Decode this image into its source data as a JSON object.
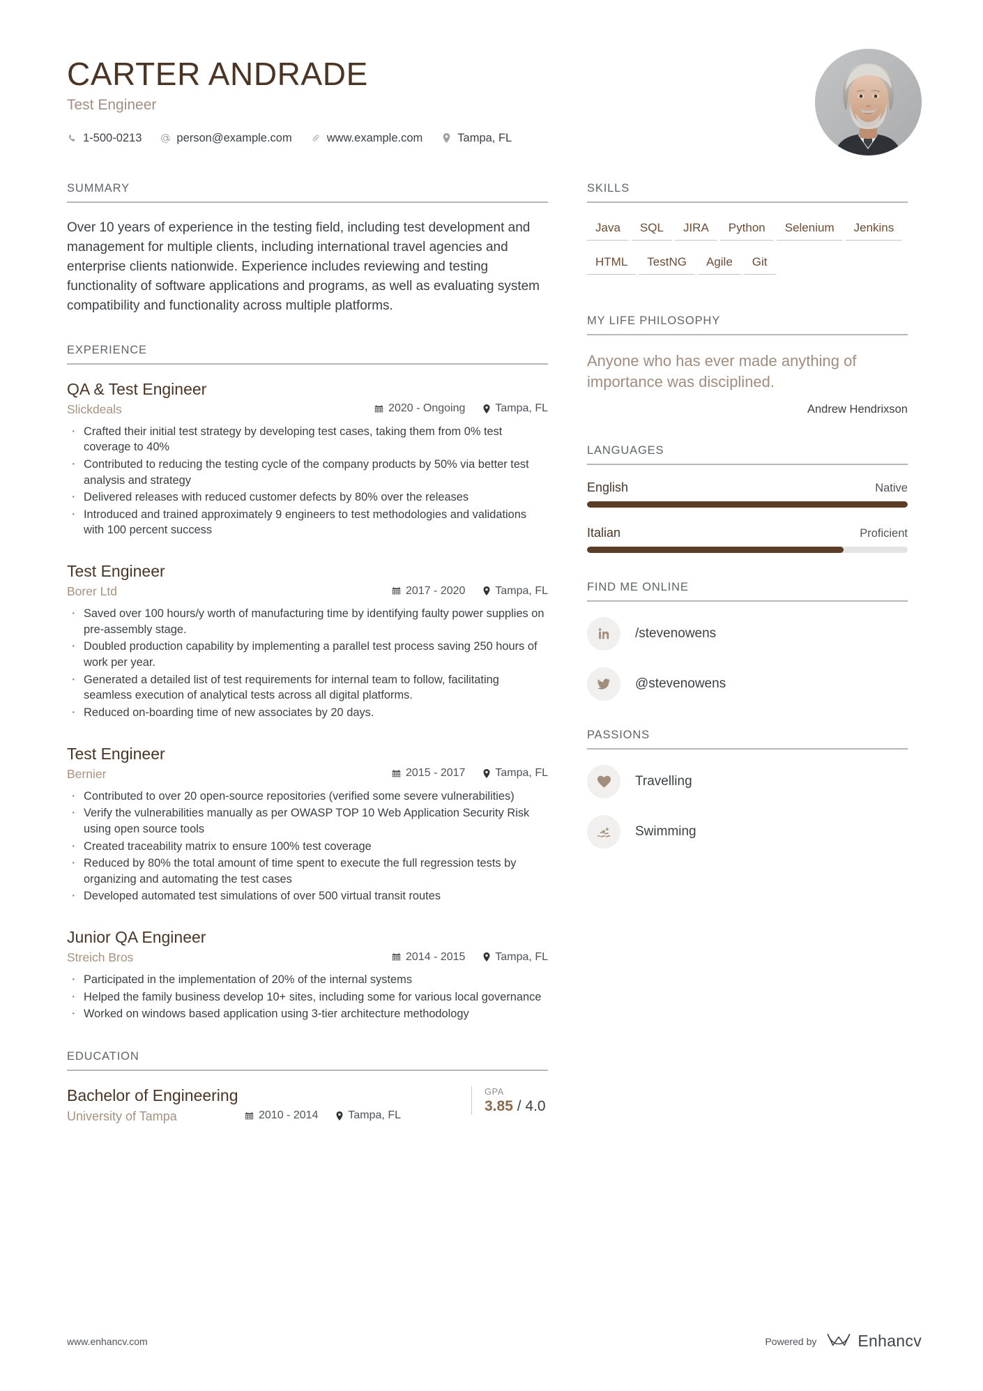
{
  "header": {
    "name": "CARTER ANDRADE",
    "job_title": "Test Engineer",
    "contacts": [
      {
        "icon": "phone-icon",
        "value": "1-500-0213"
      },
      {
        "icon": "email-icon",
        "value": "person@example.com"
      },
      {
        "icon": "link-icon",
        "value": "www.example.com"
      },
      {
        "icon": "location-pin-icon",
        "value": "Tampa, FL"
      }
    ]
  },
  "summary": {
    "title": "SUMMARY",
    "text": "Over 10 years of experience in the testing field, including test development and management for multiple clients, including international travel agencies and enterprise clients nationwide. Experience includes reviewing and testing functionality of software applications and programs, as well as evaluating system compatibility and functionality across multiple platforms."
  },
  "experience": {
    "title": "EXPERIENCE",
    "jobs": [
      {
        "role": "QA & Test Engineer",
        "company": "Slickdeals",
        "dates": "2020 - Ongoing",
        "location": "Tampa, FL",
        "bullets": [
          "Crafted their initial test strategy by developing test cases, taking them from 0% test coverage to 40%",
          "Contributed to reducing the testing cycle of the company products by 50% via better test analysis and strategy",
          "Delivered releases with reduced customer defects by 80% over the releases",
          "Introduced and trained approximately 9 engineers to test methodologies and validations with 100 percent success"
        ]
      },
      {
        "role": "Test Engineer",
        "company": "Borer Ltd",
        "dates": "2017 - 2020",
        "location": "Tampa, FL",
        "bullets": [
          "Saved over 100 hours/y worth of manufacturing time by identifying faulty power supplies on pre-assembly stage.",
          "Doubled production capability by implementing a parallel test process saving 250 hours of work per year.",
          "Generated a detailed list of test requirements for internal team to follow, facilitating seamless execution of analytical tests across all digital platforms.",
          "Reduced on-boarding time of new associates by 20 days."
        ]
      },
      {
        "role": "Test Engineer",
        "company": "Bernier",
        "dates": "2015 - 2017",
        "location": "Tampa, FL",
        "bullets": [
          "Contributed to over 20 open-source repositories (verified some severe vulnerabilities)",
          "Verify the vulnerabilities manually as per OWASP TOP 10 Web Application Security Risk using open source tools",
          "Created traceability matrix to ensure 100% test coverage",
          "Reduced by 80% the total amount of time spent to execute the full regression tests by organizing and automating the test cases",
          "Developed automated test simulations of over 500 virtual transit routes"
        ]
      },
      {
        "role": "Junior QA Engineer",
        "company": "Streich Bros",
        "dates": "2014 - 2015",
        "location": "Tampa, FL",
        "bullets": [
          "Participated in the implementation of 20% of the internal systems",
          "Helped the family business develop 10+ sites, including some for various local governance",
          "Worked on windows based application using 3-tier architecture methodology"
        ]
      }
    ]
  },
  "education": {
    "title": "EDUCATION",
    "degree": "Bachelor of Engineering",
    "school": "University of Tampa",
    "dates": "2010 - 2014",
    "location": "Tampa, FL",
    "gpa_label": "GPA",
    "gpa_value": "3.85",
    "gpa_scale": "/ 4.0"
  },
  "skills": {
    "title": "SKILLS",
    "items": [
      "Java",
      "SQL",
      "JIRA",
      "Python",
      "Selenium",
      "Jenkins",
      "HTML",
      "TestNG",
      "Agile",
      "Git"
    ]
  },
  "philosophy": {
    "title": "MY LIFE PHILOSOPHY",
    "quote": "Anyone who has ever made anything of importance was disciplined.",
    "author": "Andrew Hendrixson"
  },
  "languages": {
    "title": "LANGUAGES",
    "items": [
      {
        "name": "English",
        "level": "Native",
        "percent": 100
      },
      {
        "name": "Italian",
        "level": "Proficient",
        "percent": 80
      }
    ]
  },
  "find_me_online": {
    "title": "FIND ME ONLINE",
    "items": [
      {
        "icon": "linkedin-icon",
        "handle": "/stevenowens"
      },
      {
        "icon": "twitter-icon",
        "handle": "@stevenowens"
      }
    ]
  },
  "passions": {
    "title": "PASSIONS",
    "items": [
      {
        "icon": "heart-icon",
        "label": "Travelling"
      },
      {
        "icon": "swimmer-icon",
        "label": "Swimming"
      }
    ]
  },
  "footer": {
    "site": "www.enhancv.com",
    "powered_by": "Powered by",
    "brand": "Enhancv"
  },
  "colors": {
    "name_brown": "#4a3525",
    "accent_tan": "#a7917f",
    "skill_brown": "#6a4c35",
    "bar_fill": "#5b3d25",
    "rule_grey": "#b4b6b8"
  }
}
